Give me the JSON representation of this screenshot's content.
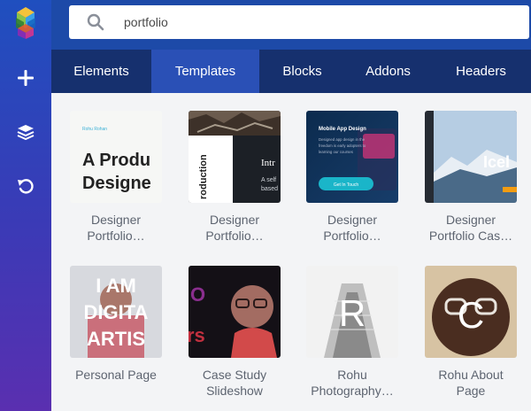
{
  "colors": {
    "rail_top": "#1f4fbf",
    "rail_bottom": "#5a2fb0",
    "topbar": "#1d4aa8",
    "tabs_bg": "#16306e",
    "tab_active": "#2a50b6",
    "content_bg": "#f3f4f6",
    "caption_text": "#5d6470"
  },
  "rail": {
    "logo_icon": "cube-logo-icon",
    "buttons": [
      {
        "icon": "plus-icon"
      },
      {
        "icon": "layers-icon"
      },
      {
        "icon": "undo-icon"
      }
    ]
  },
  "search": {
    "icon": "search-icon",
    "value": "portfolio"
  },
  "tabs": [
    {
      "label": "Elements",
      "active": false
    },
    {
      "label": "Templates",
      "active": true
    },
    {
      "label": "Blocks",
      "active": false
    },
    {
      "label": "Addons",
      "active": false
    },
    {
      "label": "Headers",
      "active": false
    }
  ],
  "templates": [
    {
      "caption_line1": "Designer",
      "caption_line2": "Portfolio…",
      "thumb_text": [
        "Rohu Rohan",
        "A Produ",
        "Designe"
      ]
    },
    {
      "caption_line1": "Designer",
      "caption_line2": "Portfolio…",
      "thumb_text": [
        "roduction",
        "Intr",
        "A self",
        "based"
      ]
    },
    {
      "caption_line1": "Designer",
      "caption_line2": "Portfolio…",
      "thumb_text": [
        "Mobile App Design",
        "Designed app design in the",
        "freedom is early adopters to",
        "learning our courses",
        "Get In Touch"
      ]
    },
    {
      "caption_line1": "Designer",
      "caption_line2": "Portfolio Cas…",
      "thumb_text": [
        "Icel"
      ]
    },
    {
      "caption_line1": "Personal Page",
      "caption_line2": "",
      "thumb_text": [
        "I AM",
        "DIGITA",
        "ARTIS"
      ]
    },
    {
      "caption_line1": "Case Study",
      "caption_line2": "Slideshow",
      "thumb_text": [
        "O",
        "rs"
      ]
    },
    {
      "caption_line1": "Rohu",
      "caption_line2": "Photography…",
      "thumb_text": [
        "R"
      ]
    },
    {
      "caption_line1": "Rohu About",
      "caption_line2": "Page",
      "thumb_text": [
        "C"
      ]
    }
  ]
}
